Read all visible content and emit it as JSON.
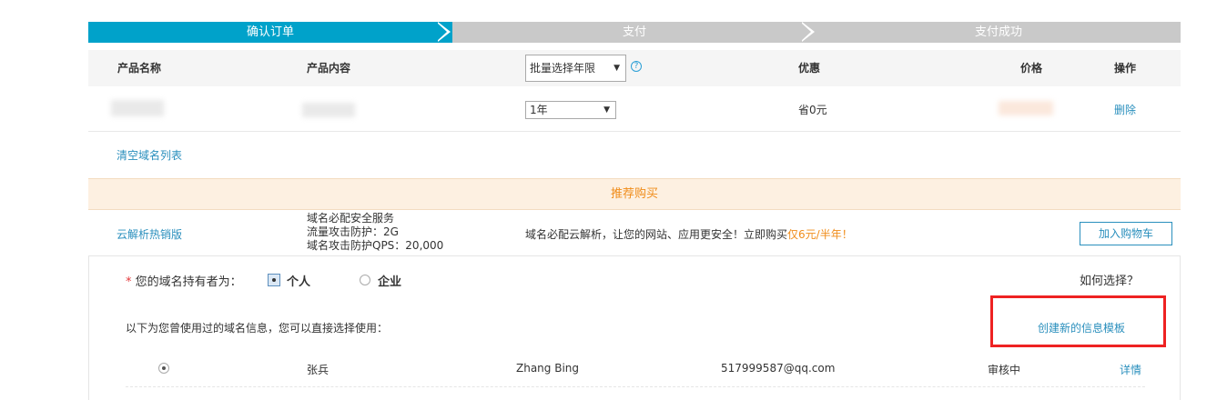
{
  "steps": [
    "确认订单",
    "支付",
    "支付成功"
  ],
  "table": {
    "headers": {
      "name": "产品名称",
      "content": "产品内容",
      "period_select": "批量选择年限",
      "discount": "优惠",
      "price": "价格",
      "action": "操作"
    },
    "row": {
      "period": "1年",
      "discount": "省0元",
      "action": "删除"
    }
  },
  "clear_list": "清空域名列表",
  "recommend": {
    "title": "推荐购买",
    "product": "云解析热销版",
    "features": [
      "域名必配安全服务",
      "流量攻击防护：2G",
      "域名攻击防护QPS：20,000"
    ],
    "desc_prefix": "域名必配云解析，让您的网站、应用更安全！立即购买",
    "desc_highlight": "仅6元/半年！",
    "add_cart": "加入购物车"
  },
  "holder": {
    "required_mark": "*",
    "label": "您的域名持有者为：",
    "options": [
      "个人",
      "企业"
    ],
    "selected": "个人",
    "help": "如何选择？"
  },
  "template_info": {
    "note": "以下为您曾使用过的域名信息，您可以直接选择使用：",
    "create_link": "创建新的信息模板"
  },
  "contact": {
    "name_cn": "张兵",
    "name_en": "Zhang Bing",
    "email": "517999587@qq.com",
    "status": "审核中",
    "detail": "详情"
  },
  "colors": {
    "accent": "#00a2ca",
    "link": "#2a8fbd",
    "highlight": "#f08c1a",
    "annotation": "#ee2222"
  }
}
